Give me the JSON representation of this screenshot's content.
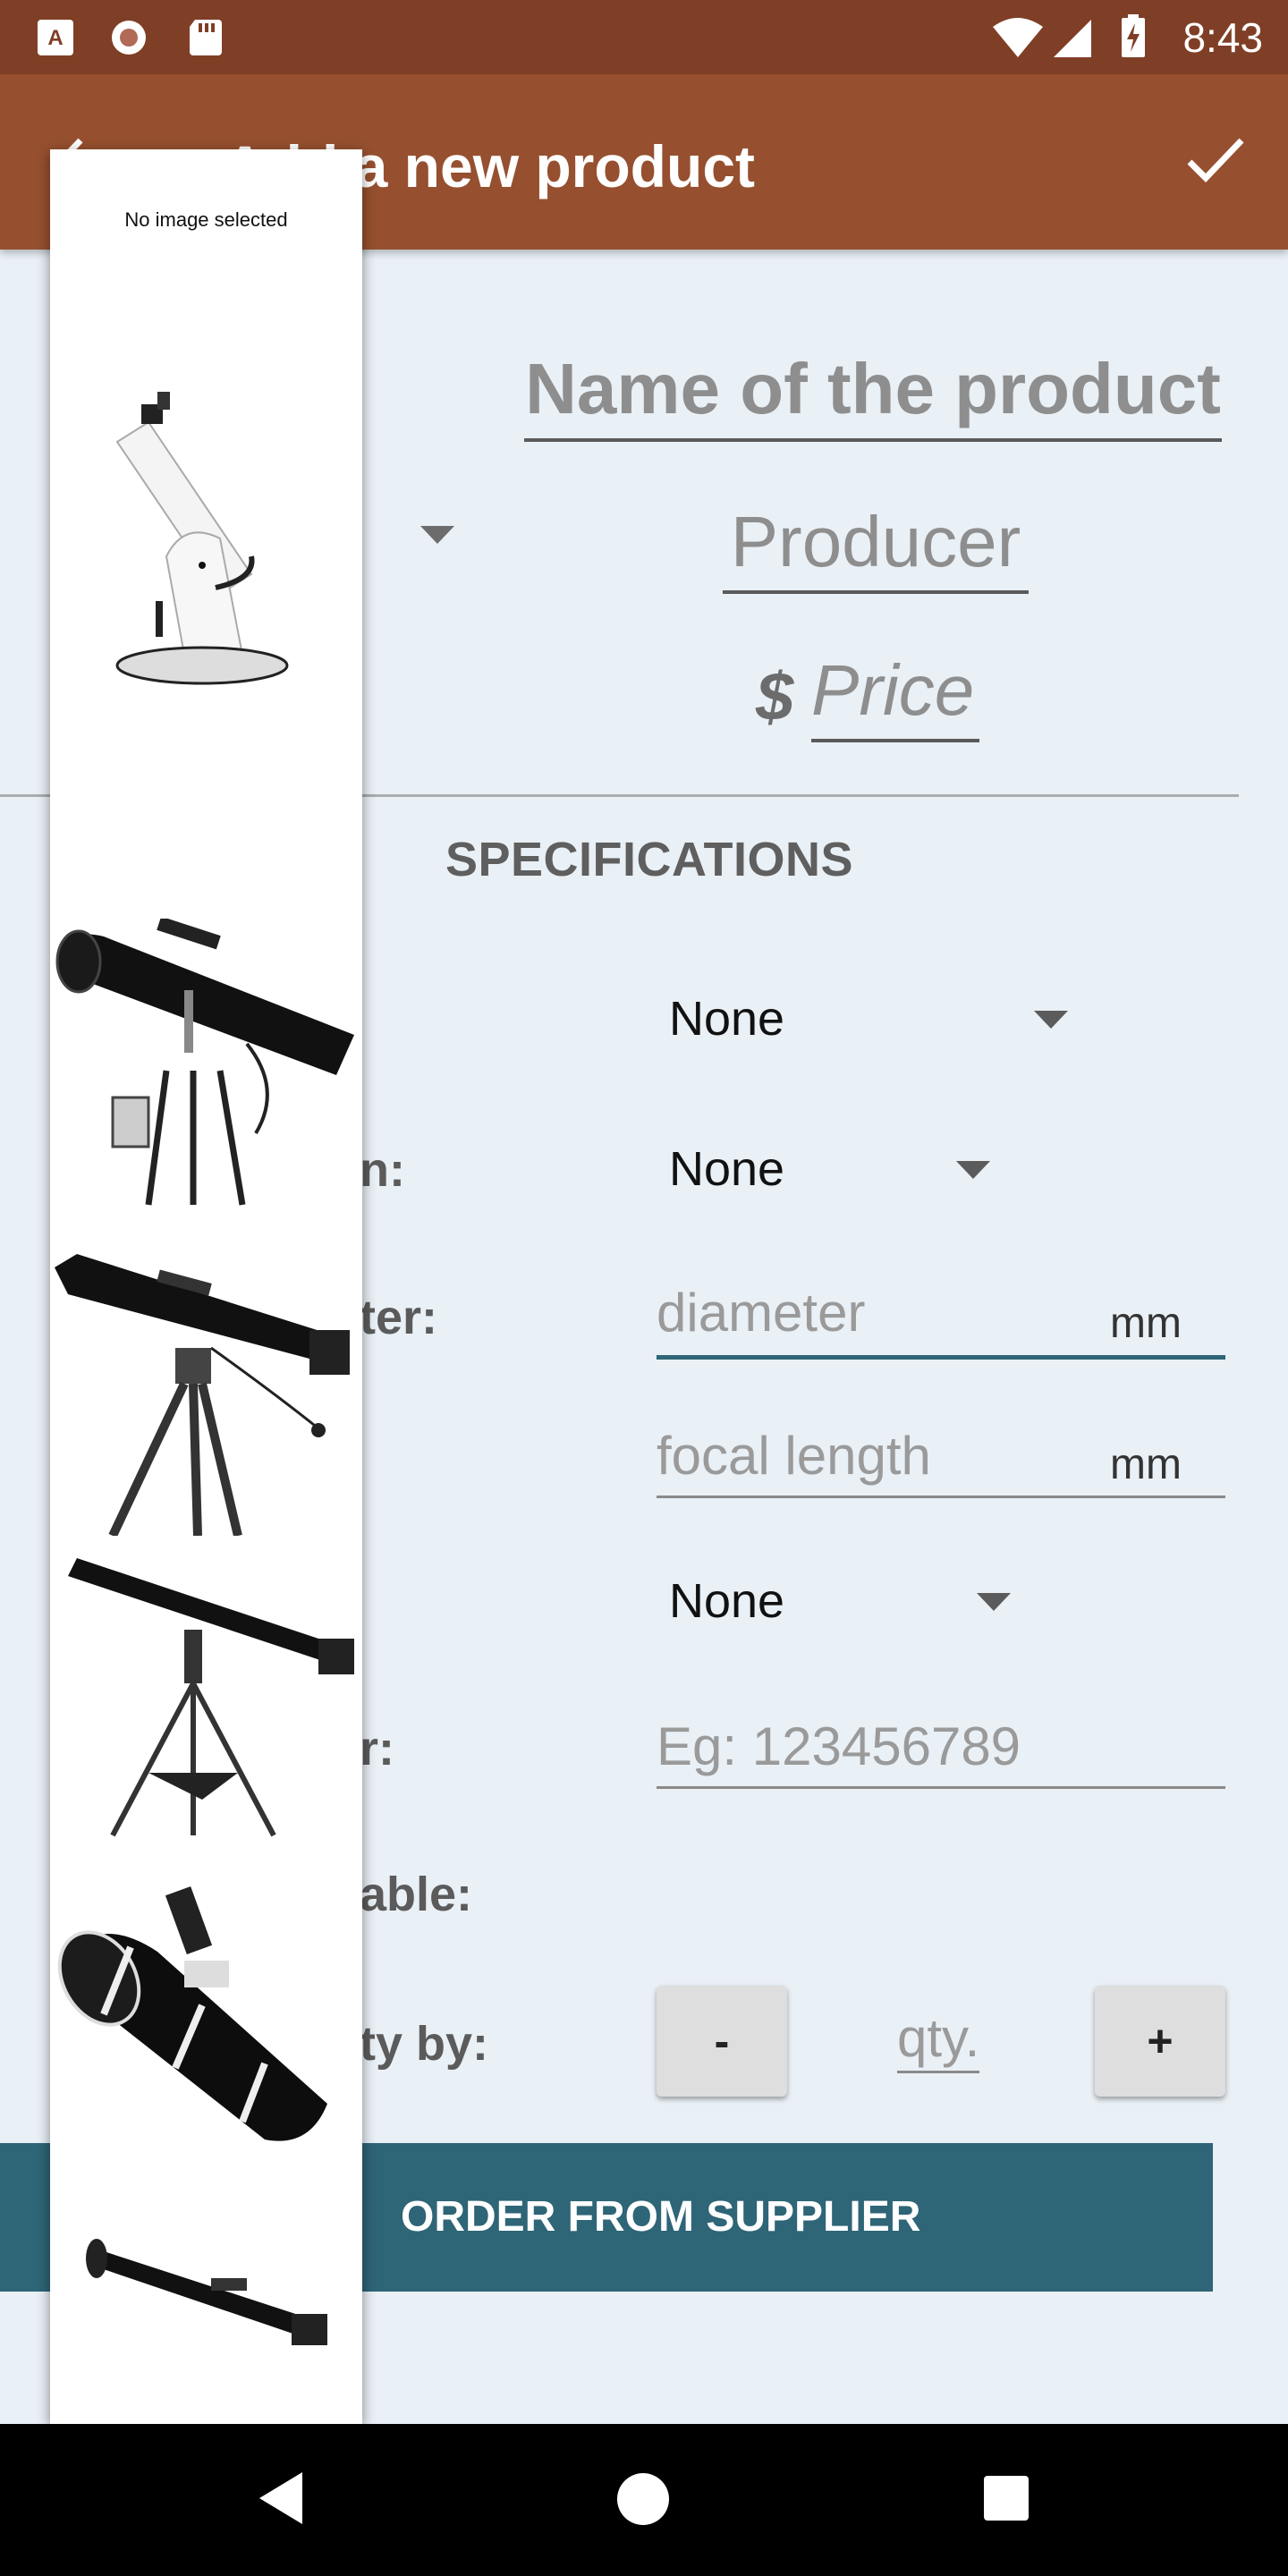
{
  "status_bar": {
    "time": "8:43",
    "left_icons": [
      "a-notification-icon",
      "record-icon",
      "sd-card-icon"
    ],
    "right_icons": [
      "wifi-icon",
      "signal-icon",
      "battery-charging-icon"
    ]
  },
  "app_bar": {
    "title": "Add a new product",
    "back_icon": "arrow-back-icon",
    "confirm_icon": "check-icon"
  },
  "form": {
    "name_placeholder": "Name of the product",
    "producer_placeholder": "Producer",
    "currency_symbol": "$",
    "price_placeholder": "Price",
    "specifications_title": "SPECIFICATIONS",
    "rows": {
      "mount_dropdown_value": "None",
      "design_label": "n:",
      "design_dropdown_value": "None",
      "diameter_label": "ter:",
      "diameter_placeholder": "diameter",
      "diameter_unit": "mm",
      "focal_placeholder": "focal length",
      "focal_unit": "mm",
      "third_dropdown_value": "None",
      "serial_label": "r:",
      "serial_placeholder": "Eg: 123456789",
      "available_label": "able:",
      "quantity_label": "ty by:",
      "minus_label": "-",
      "qty_placeholder": "qty.",
      "plus_label": "+"
    },
    "order_button": "ORDER FROM SUPPLIER"
  },
  "image_picker": {
    "caption": "No image selected",
    "images": [
      "dobsonian-telescope",
      "newtonian-reflector-on-eq-mount",
      "refractor-on-tripod",
      "long-refractor-on-tripod",
      "black-white-newtonian-tube",
      "short-refractor-tube"
    ]
  },
  "nav_bar": {
    "icons": [
      "back-triangle-icon",
      "home-circle-icon",
      "recents-square-icon"
    ]
  },
  "colors": {
    "status_bar": "#7f3f26",
    "app_bar": "#96502f",
    "background": "#e9f0f6",
    "order_button": "#2e6577",
    "focused_underline": "#2e6577"
  }
}
